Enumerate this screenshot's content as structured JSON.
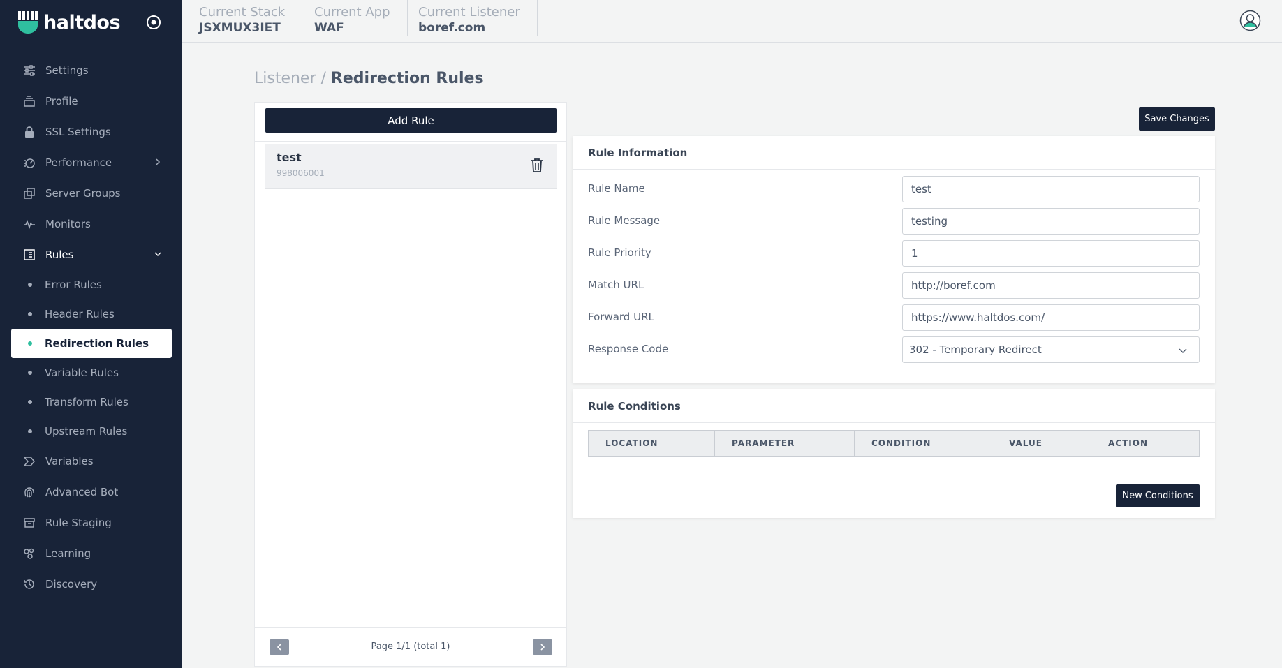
{
  "brand": {
    "name": "haltdos"
  },
  "sidebar": {
    "items": [
      {
        "label": "Settings",
        "icon": "sliders-icon"
      },
      {
        "label": "Profile",
        "icon": "layers-icon"
      },
      {
        "label": "SSL Settings",
        "icon": "lock-icon"
      },
      {
        "label": "Performance",
        "icon": "gauge-icon"
      },
      {
        "label": "Server Groups",
        "icon": "copy-icon"
      },
      {
        "label": "Monitors",
        "icon": "pulse-icon"
      },
      {
        "label": "Rules",
        "icon": "list-icon"
      }
    ],
    "rules_sub": [
      {
        "label": "Error Rules"
      },
      {
        "label": "Header Rules"
      },
      {
        "label": "Redirection Rules"
      },
      {
        "label": "Variable Rules"
      },
      {
        "label": "Transform Rules"
      },
      {
        "label": "Upstream Rules"
      }
    ],
    "items_after": [
      {
        "label": "Variables",
        "icon": "sigma-icon"
      },
      {
        "label": "Advanced Bot",
        "icon": "fingerprint-icon"
      },
      {
        "label": "Rule Staging",
        "icon": "archive-icon"
      },
      {
        "label": "Learning",
        "icon": "nodes-icon"
      },
      {
        "label": "Discovery",
        "icon": "history-icon"
      }
    ]
  },
  "header": {
    "stack_label": "Current Stack",
    "stack_value": "JSXMUX3IET",
    "app_label": "Current App",
    "app_value": "WAF",
    "listener_label": "Current Listener",
    "listener_value": "boref.com"
  },
  "page": {
    "crumb": "Listener /",
    "title": "Redirection Rules"
  },
  "left_panel": {
    "add_rule_label": "Add Rule",
    "rules": [
      {
        "name": "test",
        "id": "998006001"
      }
    ],
    "pager_text": "Page 1/1 (total 1)"
  },
  "toolbar": {
    "save_label": "Save Changes"
  },
  "rule_info": {
    "title": "Rule Information",
    "fields": [
      {
        "label": "Rule Name",
        "value": "test"
      },
      {
        "label": "Rule Message",
        "value": "testing"
      },
      {
        "label": "Rule Priority",
        "value": "1"
      },
      {
        "label": "Match URL",
        "value": "http://boref.com"
      },
      {
        "label": "Forward URL",
        "value": "https://www.haltdos.com/"
      },
      {
        "label": "Response Code",
        "value": "302 - Temporary Redirect"
      }
    ]
  },
  "rule_conditions": {
    "title": "Rule Conditions",
    "columns": [
      "LOCATION",
      "PARAMETER",
      "CONDITION",
      "VALUE",
      "ACTION"
    ],
    "new_label": "New Conditions"
  },
  "colors": {
    "sidebar_bg": "#182338",
    "accent": "#2fbf9f",
    "button_bg": "#182338"
  }
}
